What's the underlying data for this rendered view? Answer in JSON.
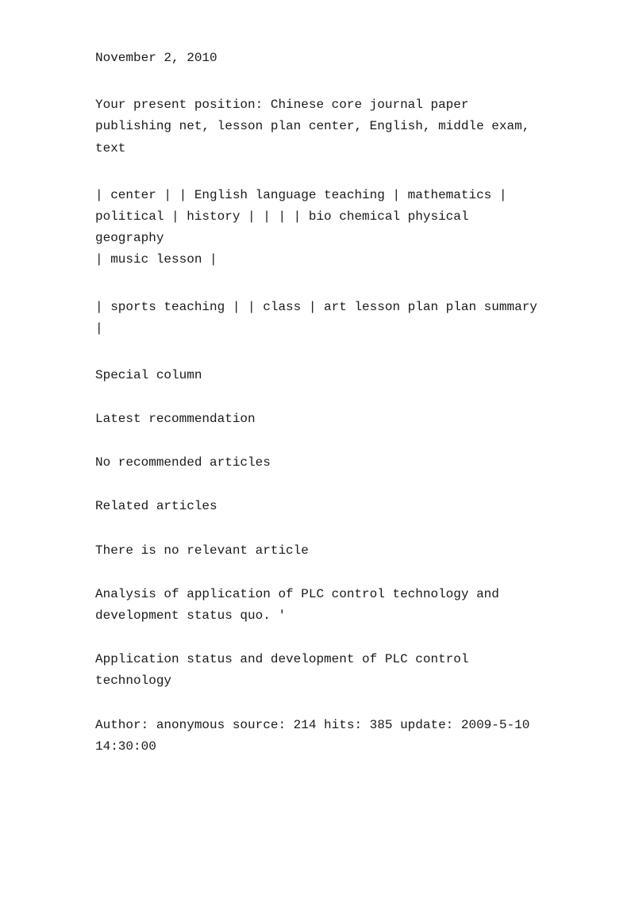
{
  "date": "November 2, 2010",
  "breadcrumb": {
    "line1": "Your present position: Chinese core journal paper",
    "line2": "publishing net, lesson plan center, English, middle exam,",
    "line3": "text"
  },
  "nav1": {
    "line1": "| center | | English language teaching | mathematics |",
    "line2": "political | history | | | | bio chemical physical geography",
    "line3": "| music lesson |"
  },
  "nav2": {
    "line1": "| sports teaching | | class | art lesson plan plan summary",
    "line2": "|"
  },
  "special_column": "Special column",
  "latest_recommendation": "Latest recommendation",
  "no_recommended": "No recommended articles",
  "related_articles": "Related articles",
  "no_relevant": "There is no relevant article",
  "article1": {
    "line1": "Analysis of application of PLC control technology and",
    "line2": "development status quo. '"
  },
  "article2": {
    "line1": "Application status and development of PLC control",
    "line2": "technology"
  },
  "author_info": {
    "line1": "Author: anonymous source: 214 hits: 385 update: 2009-5-10",
    "line2": "14:30:00"
  }
}
